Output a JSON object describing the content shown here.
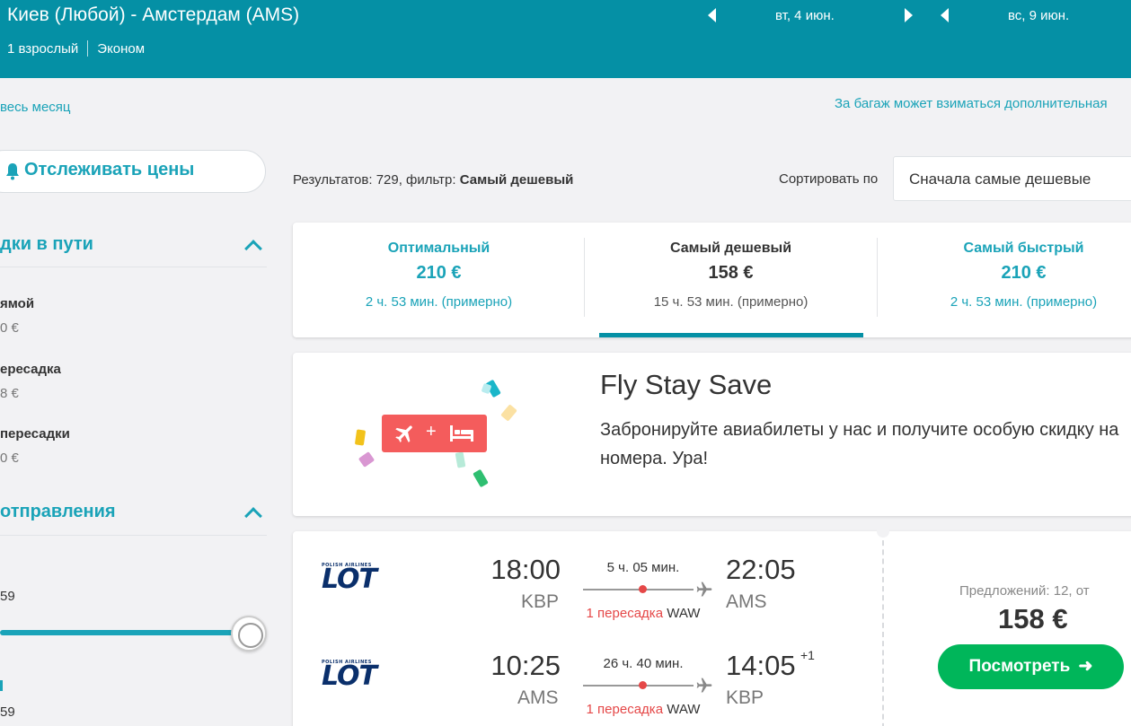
{
  "header": {
    "route": "Киев (Любой) - Амстердам (AMS)",
    "passengers": "1 взрослый",
    "cabin": "Эконом",
    "depart_date": "вт, 4 июн.",
    "return_date": "вс, 9 июн."
  },
  "left": {
    "whole_month": "весь месяц",
    "track_prices": "Отслеживать цены",
    "stops_section": "дки в пути",
    "stop_options": [
      {
        "label": "ямой",
        "price": "0 €"
      },
      {
        "label": "ересадка",
        "price": "8 €"
      },
      {
        "label": "пересадки",
        "price": "0 €"
      }
    ],
    "departure_section": "отправления",
    "slider_value_1": "59",
    "slider_value_2": "59"
  },
  "baggage_note": "За багаж может взиматься дополнительная",
  "results": {
    "prefix": "Результатов: 729, фильтр:",
    "filter": "Самый дешевый",
    "sort_label": "Сортировать по",
    "sort_value": "Сначала самые дешевые"
  },
  "tabs": [
    {
      "label": "Оптимальный",
      "price": "210 €",
      "duration": "2 ч. 53 мин. (примерно)"
    },
    {
      "label": "Самый дешевый",
      "price": "158 €",
      "duration": "15 ч. 53 мин. (примерно)"
    },
    {
      "label": "Самый быстрый",
      "price": "210 €",
      "duration": "2 ч. 53 мин. (примерно)"
    }
  ],
  "active_tab_index": 1,
  "promo": {
    "title": "Fly Stay Save",
    "text": "Забронируйте авиабилеты у нас и получите особую скидку на номера. Ура!",
    "badge_plus": "+"
  },
  "flight": {
    "airline_small": "POLISH AIRLINES",
    "airline_logo": "LOT",
    "outbound": {
      "depart_time": "18:00",
      "depart_code": "KBP",
      "duration": "5 ч. 05 мин.",
      "stops": "1 пересадка",
      "via": "WAW",
      "arrive_time": "22:05",
      "arrive_code": "AMS"
    },
    "inbound": {
      "depart_time": "10:25",
      "depart_code": "AMS",
      "duration": "26 ч. 40 мин.",
      "stops": "1 пересадка",
      "via": "WAW",
      "arrive_time": "14:05",
      "arrive_plus": "+1",
      "arrive_code": "KBP"
    },
    "offers": "Предложений: 12, от",
    "price": "158 €",
    "view_button": "Посмотреть"
  },
  "colors": {
    "header_bg": "#0590a5",
    "accent": "#1aa3b8",
    "promo_red": "#f45c5c",
    "button_green": "#00b65a",
    "stops_red": "#e54848"
  }
}
